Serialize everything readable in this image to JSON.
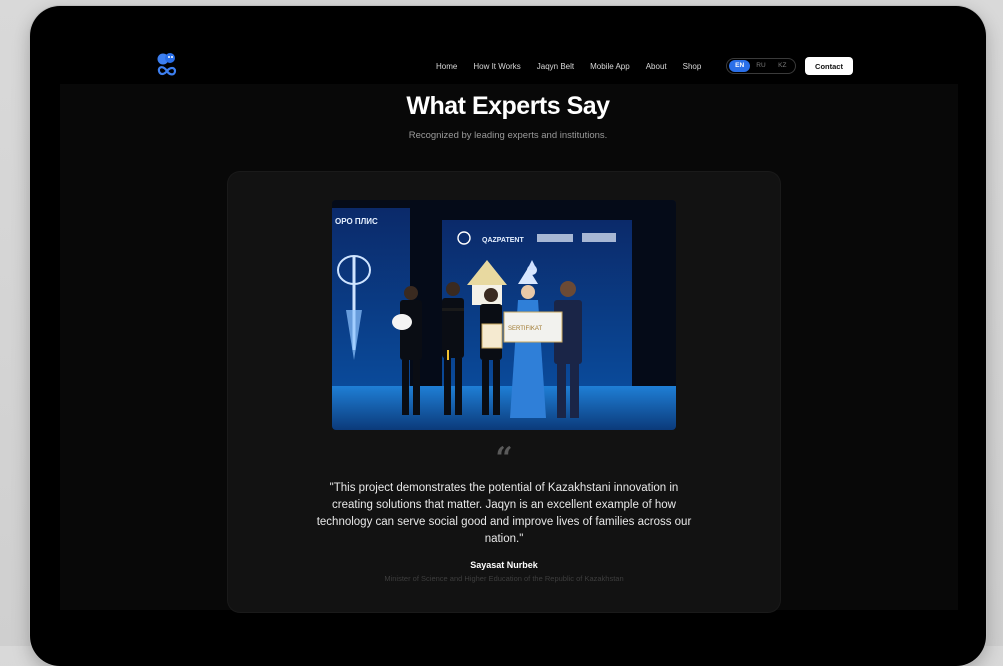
{
  "nav": {
    "links": [
      "Home",
      "How It Works",
      "Jaqyn Belt",
      "Mobile App",
      "About",
      "Shop"
    ],
    "languages": [
      "EN",
      "RU",
      "KZ"
    ],
    "active_language": "EN",
    "contact_label": "Contact"
  },
  "section": {
    "title": "What Experts Say",
    "subtitle": "Recognized by leading experts and institutions."
  },
  "testimonial": {
    "photo_banner_left": "ОРО ПЛИС",
    "photo_banner_right": "QAZPATENT",
    "photo_certificate_label": "SERTIFIKAT",
    "quote_mark": "“",
    "quote": "\"This project demonstrates the potential of Kazakhstani innovation in creating solutions that matter. Jaqyn is an excellent example of how technology can serve social good and improve lives of families across our nation.\"",
    "author": "Sayasat Nurbek",
    "author_title": "Minister of Science and Higher Education of the Republic of Kazakhstan"
  },
  "colors": {
    "accent": "#2a6fe8",
    "background": "#000000",
    "card": "#121212"
  }
}
